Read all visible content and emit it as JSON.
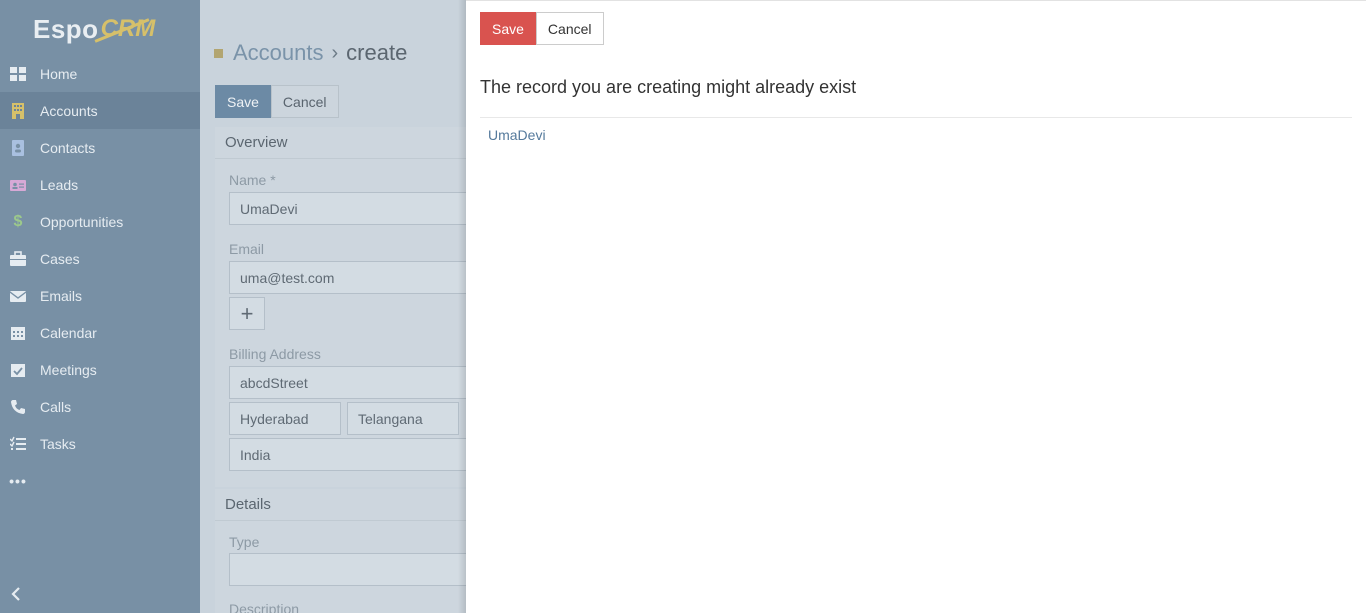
{
  "logo": {
    "espo": "Espo",
    "crm": "CRM"
  },
  "sidebar": {
    "items": [
      {
        "label": "Home",
        "icon": "th-large-icon",
        "color": "#e6ecf1"
      },
      {
        "label": "Accounts",
        "icon": "building-icon",
        "color": "#d6c06a",
        "active": true
      },
      {
        "label": "Contacts",
        "icon": "address-book-icon",
        "color": "#a9c0e0"
      },
      {
        "label": "Leads",
        "icon": "address-card-icon",
        "color": "#d7a9d6"
      },
      {
        "label": "Opportunities",
        "icon": "dollar-icon",
        "color": "#9cc98b"
      },
      {
        "label": "Cases",
        "icon": "briefcase-icon",
        "color": "#e6ecf1"
      },
      {
        "label": "Emails",
        "icon": "envelope-icon",
        "color": "#e6ecf1"
      },
      {
        "label": "Calendar",
        "icon": "calendar-icon",
        "color": "#e6ecf1"
      },
      {
        "label": "Meetings",
        "icon": "calendar-check-icon",
        "color": "#e6ecf1"
      },
      {
        "label": "Calls",
        "icon": "phone-icon",
        "color": "#e6ecf1"
      },
      {
        "label": "Tasks",
        "icon": "tasks-icon",
        "color": "#e6ecf1"
      }
    ],
    "more_icon": "ellipsis-icon",
    "collapse_icon": "chevron-left-icon"
  },
  "breadcrumb": {
    "parent": "Accounts",
    "separator": "›",
    "current": "create"
  },
  "main": {
    "save_label": "Save",
    "cancel_label": "Cancel",
    "overview": {
      "title": "Overview",
      "name_label": "Name *",
      "name_value": "UmaDevi",
      "email_label": "Email",
      "email_value": "uma@test.com",
      "add_label": "+",
      "billing_label": "Billing Address",
      "street": "abcdStreet",
      "city": "Hyderabad",
      "state": "Telangana",
      "country": "India"
    },
    "details": {
      "title": "Details",
      "type_label": "Type",
      "type_value": "",
      "description_label": "Description"
    }
  },
  "modal": {
    "save_label": "Save",
    "cancel_label": "Cancel",
    "message": "The record you are creating might already exist",
    "duplicates": [
      "UmaDevi"
    ]
  },
  "colors": {
    "sidebar_bg": "#7890a5",
    "save_danger": "#d9534f",
    "link": "#557a9c"
  }
}
